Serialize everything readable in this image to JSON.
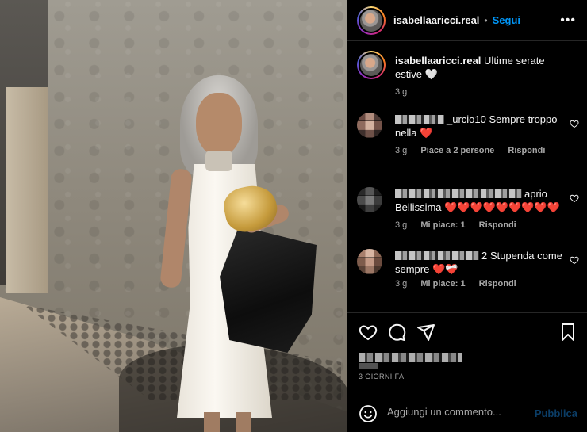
{
  "post": {
    "username": "isabellaaricci.real",
    "follow_label": "Segui",
    "separator": "•",
    "more_icon": "more-icon"
  },
  "caption": {
    "username": "isabellaaricci.real",
    "text": "Ultime serate estive 🤍",
    "time": "3 g"
  },
  "comments": [
    {
      "name_suffix": "_urcio10",
      "text": "Sempre troppo nella ❤️",
      "time": "3 g",
      "likes": "Piace a 2 persone",
      "reply": "Rispondi"
    },
    {
      "name_suffix": "aprio",
      "text": "Bellissima ❤️❤️❤️❤️❤️❤️❤️❤️❤️",
      "time": "3 g",
      "likes": "Mi piace: 1",
      "reply": "Rispondi"
    },
    {
      "name_suffix": "2",
      "text": "Stupenda come sempre ❤️❤️‍🩹",
      "time": "3 g",
      "likes": "Mi piace: 1",
      "reply": "Rispondi"
    }
  ],
  "actions": {
    "icons": [
      "heart-icon",
      "comment-icon",
      "share-icon",
      "bookmark-icon"
    ],
    "date": "3 GIORNI FA"
  },
  "compose": {
    "placeholder": "Aggiungi un commento...",
    "publish_label": "Pubblica",
    "emoji_icon": "emoji-icon"
  },
  "colors": {
    "background": "#000000",
    "link_blue": "#0095f6",
    "publish_disabled": "#0b3d66",
    "muted_text": "#a8a8a8",
    "divider": "#262626"
  }
}
